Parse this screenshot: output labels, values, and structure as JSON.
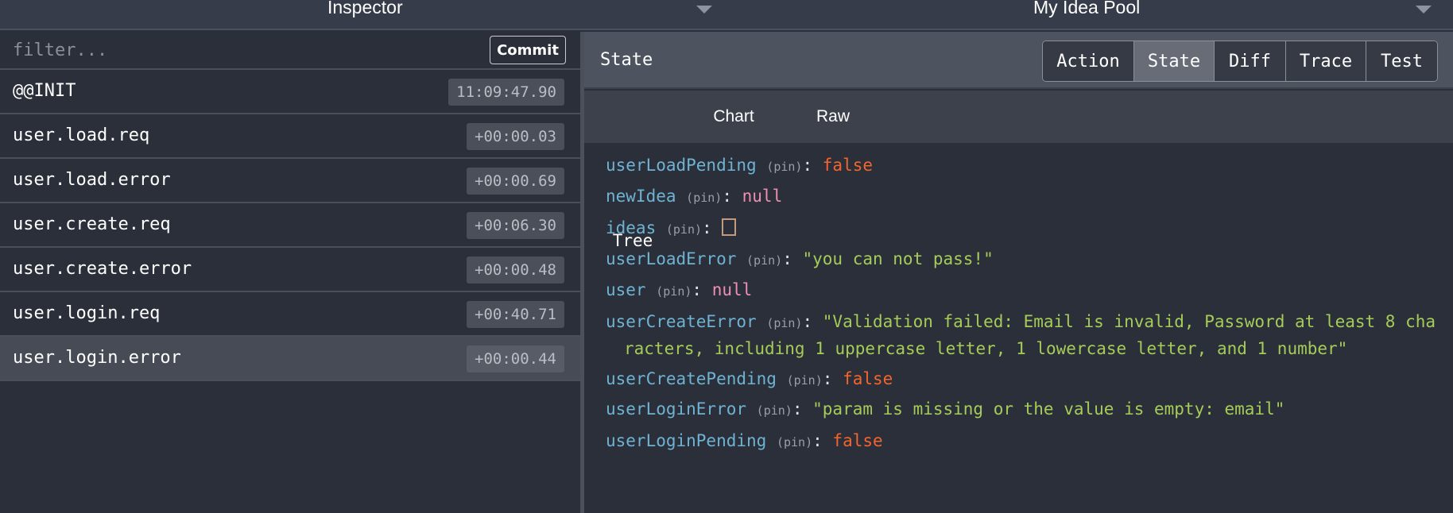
{
  "topbar": {
    "left_title": "Inspector",
    "right_title": "My Idea Pool"
  },
  "filter": {
    "placeholder": "filter...",
    "value": "",
    "commit_label": "Commit"
  },
  "actions": [
    {
      "name": "@@INIT",
      "time": "11:09:47.90",
      "selected": false
    },
    {
      "name": "user.load.req",
      "time": "+00:00.03",
      "selected": false
    },
    {
      "name": "user.load.error",
      "time": "+00:00.69",
      "selected": false
    },
    {
      "name": "user.create.req",
      "time": "+00:06.30",
      "selected": false
    },
    {
      "name": "user.create.error",
      "time": "+00:00.48",
      "selected": false
    },
    {
      "name": "user.login.req",
      "time": "+00:40.71",
      "selected": false
    },
    {
      "name": "user.login.error",
      "time": "+00:00.44",
      "selected": true
    }
  ],
  "monitor": {
    "title": "State",
    "tabs": [
      "Action",
      "State",
      "Diff",
      "Trace",
      "Test"
    ],
    "active_tab": "State",
    "sub_tabs": [
      "Tree",
      "Chart",
      "Raw"
    ],
    "active_sub_tab": "Tree"
  },
  "tree": {
    "pin_label": "(pin)",
    "colon": ":",
    "rows": [
      {
        "key": "userLoadPending",
        "value": "false",
        "type": "boolean"
      },
      {
        "key": "newIdea",
        "value": "null",
        "type": "null"
      },
      {
        "key": "ideas",
        "value": "",
        "type": "array-empty"
      },
      {
        "key": "userLoadError",
        "value": "\"you can not pass!\"",
        "type": "string"
      },
      {
        "key": "user",
        "value": "null",
        "type": "null"
      },
      {
        "key": "userCreateError",
        "value": "\"Validation failed: Email is invalid, Password at least 8 cha",
        "continuation": "racters, including 1 uppercase letter, 1 lowercase letter, and 1 number\"",
        "type": "string"
      },
      {
        "key": "userCreatePending",
        "value": "false",
        "type": "boolean"
      },
      {
        "key": "userLoginError",
        "value": "\"param is missing or the value is empty: email\"",
        "type": "string"
      },
      {
        "key": "userLoginPending",
        "value": "false",
        "type": "boolean"
      }
    ]
  },
  "colors": {
    "key": "#6fb3d2",
    "boolean": "#f3652c",
    "null": "#ef8fb4",
    "string": "#a6cc58",
    "background": "#2a2f3a"
  }
}
